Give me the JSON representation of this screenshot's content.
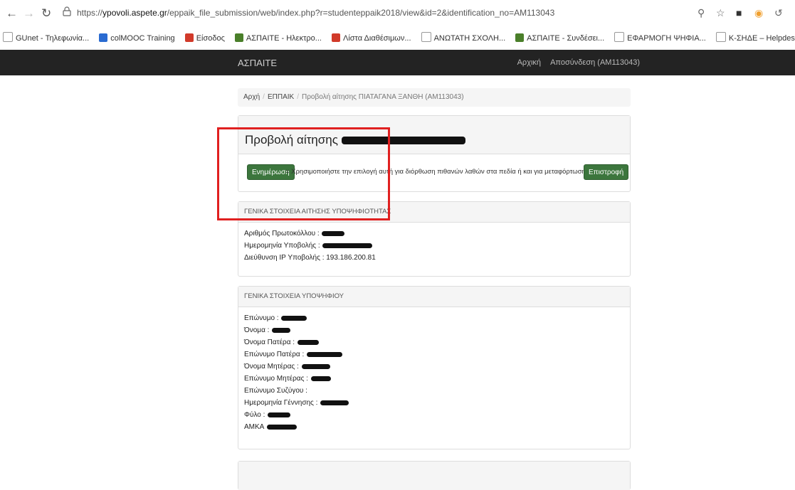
{
  "browser": {
    "url_prefix": "https://",
    "url_host": "ypovoli.aspete.gr",
    "url_path": "/eppaik_file_submission/web/index.php?r=studenteppaik2018/view&id=2&identification_no=AM113043",
    "bookmarks": [
      {
        "label": "GUnet - Τηλεφωνία...",
        "color": "#ffffff"
      },
      {
        "label": "colMOOC Training",
        "color": "#2a6bd1"
      },
      {
        "label": "Είσοδος",
        "color": "#d13a2a"
      },
      {
        "label": "ΑΣΠΑΙΤΕ - Ηλεκτρο...",
        "color": "#4a7f2a"
      },
      {
        "label": "Λίστα Διαθέσιμων...",
        "color": "#d13a2a"
      },
      {
        "label": "ΑΝΩΤΑΤΗ ΣΧΟΛΗ...",
        "color": "#ffffff"
      },
      {
        "label": "ΑΣΠΑΙΤΕ - Συνδέσει...",
        "color": "#4a7f2a"
      },
      {
        "label": "ΕΦΑΡΜΟΓΗ ΨΗΦΙΑ...",
        "color": "#ffffff"
      },
      {
        "label": "Κ-ΣΗΔΕ – Helpdesk",
        "color": "#ffffff"
      },
      {
        "label": "Κεντρικό ΣΗΔΕ - Ε...",
        "color": "#3b6fd8"
      },
      {
        "label": "Free QR Code Read...",
        "color": "#2f8fe8"
      },
      {
        "label": "Κεντρικό ΣΗΔΕ - Ε...",
        "color": "#3b6fd8"
      }
    ]
  },
  "navbar": {
    "brand": "ΑΣΠΑΙΤΕ",
    "links": [
      "Αρχική",
      "Αποσύνδεση (AM113043)"
    ]
  },
  "breadcrumb": {
    "home": "Αρχή",
    "section": "ΕΠΠΑΙΚ",
    "current": "Προβολή αίτησης ΠΙΑΤΑΓΑΝΑ ΞΑΝΘΗ (AM113043)"
  },
  "title": {
    "prefix": "Προβολή αίτησης",
    "update_button": "Ενημέρωση",
    "hint": "= Χρησιμοποιήστε την επιλογή αυτή για διόρθωση πιθανών λαθών στα πεδία ή και για μεταφόρτωση αρχείων.",
    "back_button": "Επιστροφή"
  },
  "application": {
    "heading": "ΓΕΝΙΚΑ ΣΤΟΙΧΕΙΑ ΑΙΤΗΣΗΣ ΥΠΟΨΗΦΙΟΤΗΤΑΣ",
    "protocol_label": "Αριθμός Πρωτοκόλλου :",
    "date_label": "Ημερομηνία Υποβολής :",
    "ip_label": "Διεύθυνση IP Υποβολής :",
    "ip_value": "193.186.200.81"
  },
  "candidate": {
    "heading": "ΓΕΝΙΚΑ ΣΤΟΙΧΕΙΑ ΥΠΟΨΗΦΙΟΥ",
    "fields": [
      {
        "label": "Επώνυμο :"
      },
      {
        "label": "Όνομα :"
      },
      {
        "label": "Όνομα Πατέρα :"
      },
      {
        "label": "Επώνυμο Πατέρα :"
      },
      {
        "label": "Όνομα Μητέρας :"
      },
      {
        "label": "Επώνυμο Μητέρας :"
      },
      {
        "label": "Επώνυμο Συζύγου :"
      },
      {
        "label": "Ημερομηνία Γέννησης :"
      },
      {
        "label": "Φύλο :"
      },
      {
        "label": "ΑΜΚΑ"
      }
    ]
  }
}
